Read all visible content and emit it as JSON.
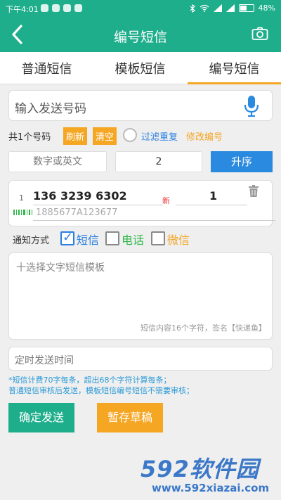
{
  "status": {
    "time": "下午4:01",
    "battery": "48%"
  },
  "appbar": {
    "title": "编号短信"
  },
  "tabs": [
    {
      "label": "普通短信"
    },
    {
      "label": "模板短信"
    },
    {
      "label": "编号短信",
      "active": true
    }
  ],
  "phone_input": {
    "placeholder": "输入发送号码"
  },
  "count_row": {
    "count_text": "共1个号码",
    "refresh": "刷新",
    "clear": "清空",
    "filter": "过滤重复",
    "edit": "修改编号"
  },
  "sort_row": {
    "prefix_placeholder": "数字或英文",
    "start": "2",
    "sort": "升序"
  },
  "entries": [
    {
      "index": "1",
      "phone": "136 3239 6302",
      "badge": "新",
      "qty": "1",
      "code": "1885677A123677"
    }
  ],
  "notify": {
    "label": "通知方式",
    "options": [
      {
        "label": "短信",
        "checked": true,
        "color": "#2a7fe0"
      },
      {
        "label": "电话",
        "checked": false,
        "color": "#2eb84a"
      },
      {
        "label": "微信",
        "checked": false,
        "color": "#f5a623"
      }
    ]
  },
  "template": {
    "placeholder": "十选择文字短信模板",
    "hint": "短信内容16个字符，签名【快递鱼】"
  },
  "schedule": {
    "placeholder": "定时发送时间"
  },
  "note": {
    "line1": "*短信计费70字每条，超出68个字符计算每条；",
    "line2": "普通短信审核后发送，模板短信编号短信不需要审核；"
  },
  "buttons": {
    "send": "确定发送",
    "draft": "暂存草稿"
  },
  "watermark": {
    "brand": "592软件园",
    "url": "www.592xiazai.com"
  },
  "colors": {
    "primary": "#1fae8b",
    "accent": "#f5a623",
    "blue": "#2a8ae0"
  }
}
